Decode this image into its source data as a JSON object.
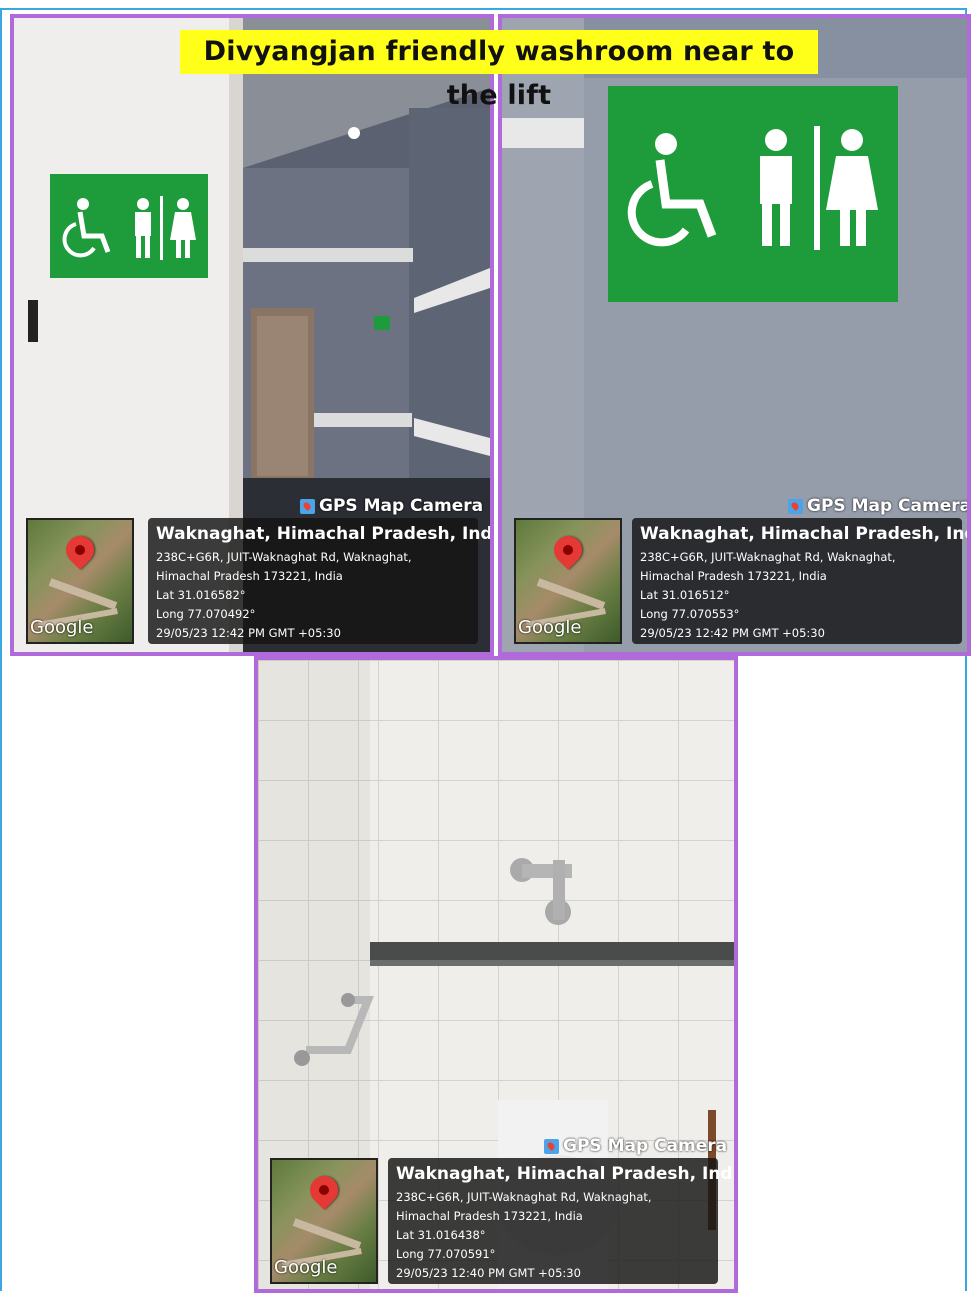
{
  "title": "Divyangjan friendly washroom near to the lift",
  "photos": [
    {
      "gps_label": "GPS Map Camera",
      "map_watermark": "Google",
      "location": "Waknaghat, Himachal Pradesh, India",
      "address_line1": "238C+G6R, JUIT-Waknaghat Rd, Waknaghat,",
      "address_line2": "Himachal Pradesh 173221, India",
      "lat": "Lat 31.016582°",
      "long": "Long 77.070492°",
      "datetime": "29/05/23 12:42 PM GMT +05:30"
    },
    {
      "gps_label": "GPS Map Camera",
      "map_watermark": "Google",
      "location": "Waknaghat, Himachal Pradesh, India",
      "address_line1": "238C+G6R, JUIT-Waknaghat Rd, Waknaghat,",
      "address_line2": "Himachal Pradesh 173221, India",
      "lat": "Lat 31.016512°",
      "long": "Long 77.070553°",
      "datetime": "29/05/23 12:42 PM GMT +05:30"
    },
    {
      "gps_label": "GPS Map Camera",
      "map_watermark": "Google",
      "location": "Waknaghat, Himachal Pradesh, India",
      "address_line1": "238C+G6R, JUIT-Waknaghat Rd, Waknaghat,",
      "address_line2": "Himachal Pradesh 173221, India",
      "lat": "Lat 31.016438°",
      "long": "Long 77.070591°",
      "datetime": "29/05/23 12:40 PM GMT +05:30"
    }
  ],
  "colors": {
    "title_bg": "#ffff1a",
    "photo_border": "#b06ad9",
    "outer_border": "#3aa7e0",
    "sign_green": "#1e9b3a"
  }
}
